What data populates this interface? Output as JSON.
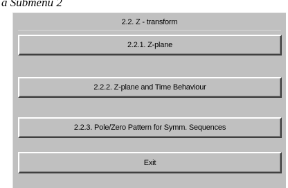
{
  "caption": "a Submenu 2",
  "window": {
    "header": "2.2. Z - transform",
    "buttons": [
      "2.2.1. Z-plane",
      "2.2.2.  Z-plane and Time Behaviour",
      "2.2.3. Pole/Zero Pattern for Symm. Sequences",
      "Exit"
    ]
  },
  "colors": {
    "face": "#c0c0c0",
    "highlight": "#ffffff",
    "shadow": "#404040"
  }
}
